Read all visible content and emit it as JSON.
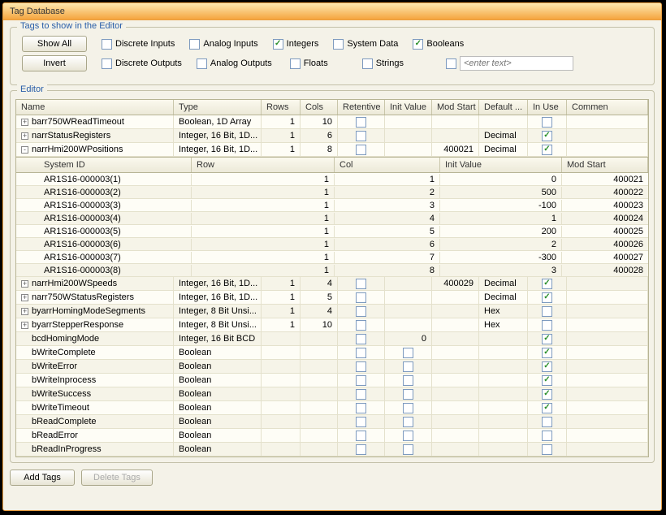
{
  "window": {
    "title": "Tag Database"
  },
  "filters": {
    "legend": "Tags to show in the Editor",
    "show_all": "Show All",
    "invert": "Invert",
    "row1": [
      {
        "label": "Discrete Inputs",
        "checked": false
      },
      {
        "label": "Analog Inputs",
        "checked": false
      },
      {
        "label": "Integers",
        "checked": true
      },
      {
        "label": "System Data",
        "checked": false
      },
      {
        "label": "Booleans",
        "checked": true
      }
    ],
    "row2": [
      {
        "label": "Discrete Outputs",
        "checked": false
      },
      {
        "label": "Analog Outputs",
        "checked": false
      },
      {
        "label": "Floats",
        "checked": false
      },
      {
        "label": "Strings",
        "checked": false
      }
    ],
    "custom_placeholder": "<enter text>"
  },
  "editor": {
    "legend": "Editor",
    "columns": [
      "Name",
      "Type",
      "Rows",
      "Cols",
      "Retentive",
      "Init Value",
      "Mod Start",
      "Default ...",
      "In Use",
      "Commen"
    ],
    "sub_columns": [
      "System ID",
      "Row",
      "Col",
      "Init Value",
      "Mod Start"
    ],
    "rows": [
      {
        "tree": "+",
        "name": "barr750WReadTimeout",
        "type": "Boolean, 1D Array",
        "rows": "1",
        "cols": "10",
        "ret": false,
        "init": "",
        "mod": "",
        "def": "",
        "use": false
      },
      {
        "tree": "+",
        "name": "narrStatusRegisters",
        "type": "Integer, 16 Bit, 1D...",
        "rows": "1",
        "cols": "6",
        "ret": false,
        "init": "",
        "mod": "",
        "def": "Decimal",
        "use": true
      },
      {
        "tree": "-",
        "name": "narrHmi200WPositions",
        "type": "Integer, 16 Bit, 1D...",
        "rows": "1",
        "cols": "8",
        "ret": false,
        "init": "",
        "mod": "400021",
        "def": "Decimal",
        "use": true,
        "children": [
          {
            "sys": "AR1S16-000003(1)",
            "row": "1",
            "col": "1",
            "init": "0",
            "mod": "400021"
          },
          {
            "sys": "AR1S16-000003(2)",
            "row": "1",
            "col": "2",
            "init": "500",
            "mod": "400022"
          },
          {
            "sys": "AR1S16-000003(3)",
            "row": "1",
            "col": "3",
            "init": "-100",
            "mod": "400023"
          },
          {
            "sys": "AR1S16-000003(4)",
            "row": "1",
            "col": "4",
            "init": "1",
            "mod": "400024"
          },
          {
            "sys": "AR1S16-000003(5)",
            "row": "1",
            "col": "5",
            "init": "200",
            "mod": "400025"
          },
          {
            "sys": "AR1S16-000003(6)",
            "row": "1",
            "col": "6",
            "init": "2",
            "mod": "400026"
          },
          {
            "sys": "AR1S16-000003(7)",
            "row": "1",
            "col": "7",
            "init": "-300",
            "mod": "400027"
          },
          {
            "sys": "AR1S16-000003(8)",
            "row": "1",
            "col": "8",
            "init": "3",
            "mod": "400028"
          }
        ]
      },
      {
        "tree": "+",
        "name": "narrHmi200WSpeeds",
        "type": "Integer, 16 Bit, 1D...",
        "rows": "1",
        "cols": "4",
        "ret": false,
        "init": "",
        "mod": "400029",
        "def": "Decimal",
        "use": true
      },
      {
        "tree": "+",
        "name": "narr750WStatusRegisters",
        "type": "Integer, 16 Bit, 1D...",
        "rows": "1",
        "cols": "5",
        "ret": false,
        "init": "",
        "mod": "",
        "def": "Decimal",
        "use": true
      },
      {
        "tree": "+",
        "name": "byarrHomingModeSegments",
        "type": "Integer, 8 Bit Unsi...",
        "rows": "1",
        "cols": "4",
        "ret": false,
        "init": "",
        "mod": "",
        "def": "Hex",
        "use": false
      },
      {
        "tree": "+",
        "name": "byarrStepperResponse",
        "type": "Integer, 8 Bit Unsi...",
        "rows": "1",
        "cols": "10",
        "ret": false,
        "init": "",
        "mod": "",
        "def": "Hex",
        "use": false
      },
      {
        "tree": "",
        "name": "bcdHomingMode",
        "type": "Integer, 16 Bit BCD",
        "rows": "",
        "cols": "",
        "ret": false,
        "init": "0",
        "mod": "",
        "def": "",
        "use": true
      },
      {
        "tree": "",
        "name": "bWriteComplete",
        "type": "Boolean",
        "rows": "",
        "cols": "",
        "ret": false,
        "init_cb": false,
        "mod": "",
        "def": "",
        "use": true
      },
      {
        "tree": "",
        "name": "bWriteError",
        "type": "Boolean",
        "rows": "",
        "cols": "",
        "ret": false,
        "init_cb": false,
        "mod": "",
        "def": "",
        "use": true
      },
      {
        "tree": "",
        "name": "bWriteInprocess",
        "type": "Boolean",
        "rows": "",
        "cols": "",
        "ret": false,
        "init_cb": false,
        "mod": "",
        "def": "",
        "use": true
      },
      {
        "tree": "",
        "name": "bWriteSuccess",
        "type": "Boolean",
        "rows": "",
        "cols": "",
        "ret": false,
        "init_cb": false,
        "mod": "",
        "def": "",
        "use": true
      },
      {
        "tree": "",
        "name": "bWriteTimeout",
        "type": "Boolean",
        "rows": "",
        "cols": "",
        "ret": false,
        "init_cb": false,
        "mod": "",
        "def": "",
        "use": true
      },
      {
        "tree": "",
        "name": "bReadComplete",
        "type": "Boolean",
        "rows": "",
        "cols": "",
        "ret": false,
        "init_cb": false,
        "mod": "",
        "def": "",
        "use": false
      },
      {
        "tree": "",
        "name": "bReadError",
        "type": "Boolean",
        "rows": "",
        "cols": "",
        "ret": false,
        "init_cb": false,
        "mod": "",
        "def": "",
        "use": false
      },
      {
        "tree": "",
        "name": "bReadInProgress",
        "type": "Boolean",
        "rows": "",
        "cols": "",
        "ret": false,
        "init_cb": false,
        "mod": "",
        "def": "",
        "use": false
      }
    ]
  },
  "footer": {
    "add": "Add Tags",
    "delete": "Delete Tags"
  }
}
